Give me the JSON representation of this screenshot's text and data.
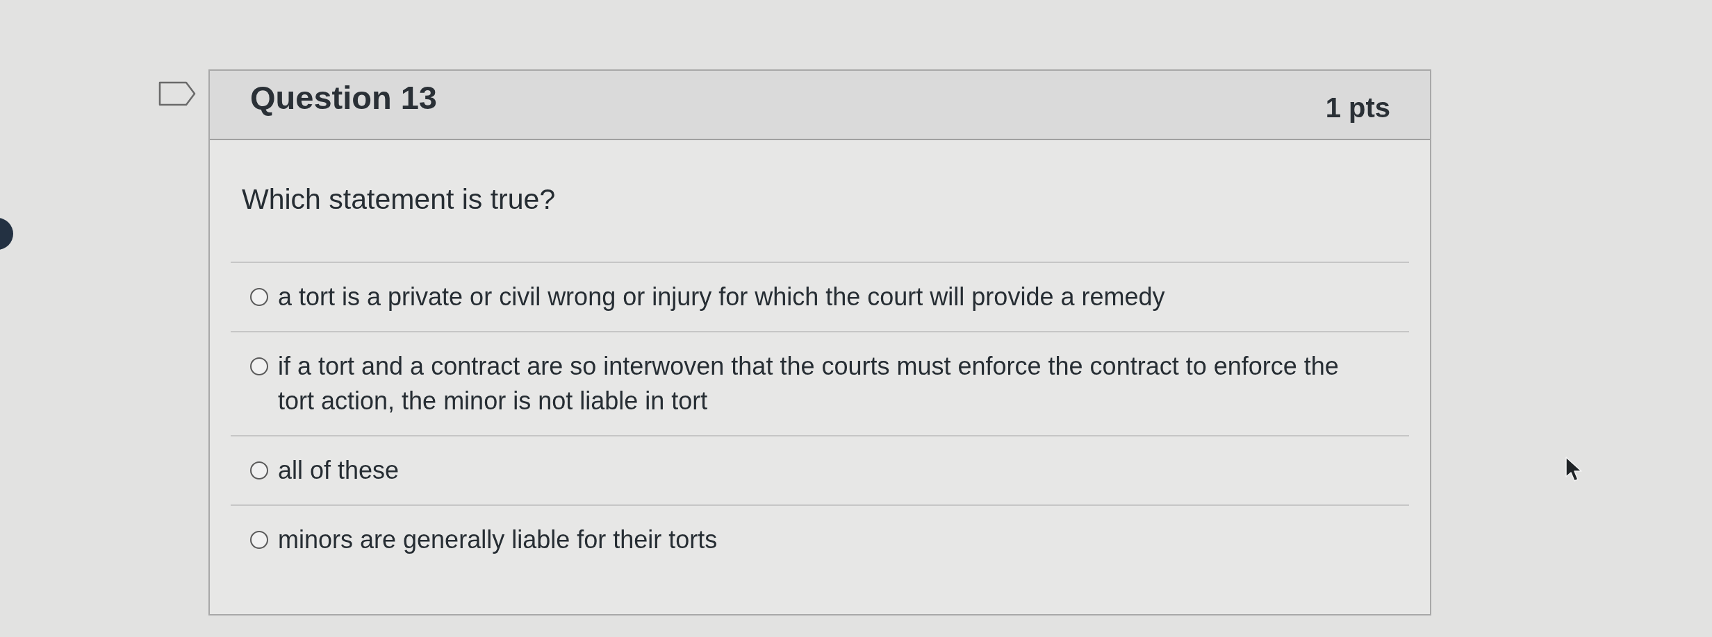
{
  "question": {
    "title": "Question 13",
    "points": "1 pts",
    "flagged": false,
    "prompt": "Which statement is true?",
    "answers": [
      {
        "text": "a tort is a private or civil wrong or injury for which the court will provide a remedy",
        "selected": false
      },
      {
        "text": "if a tort and a contract are so interwoven that the courts must enforce the contract to enforce the tort action, the minor is not liable in tort",
        "selected": false
      },
      {
        "text": "all of these",
        "selected": false
      },
      {
        "text": "minors are generally liable for their torts",
        "selected": false
      }
    ]
  }
}
